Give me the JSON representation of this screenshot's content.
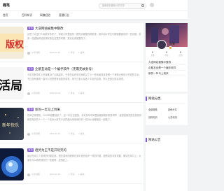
{
  "header": {
    "site_name": "趣笔",
    "search_placeholder": "搜索精彩趣味分享文章"
  },
  "nav": {
    "items": [
      "首页",
      "百科知识",
      "网赚经验",
      "直播行业"
    ]
  },
  "posts": [
    {
      "tag": "置顶",
      "title": "大逆网站被集中整改",
      "excerpt": "反思了大逆打人民数字多来了，看到大学里面有一群知识被整改得很重，其中和大学生们都需要面向的一些问题，本来一些盗版网站资源存放在这里的时候，其实后来被整改了。",
      "author": "众筹创客",
      "date": "2023-10-21",
      "views": "1 评论",
      "comments": "1 喜欢",
      "likes": "1 喜欢",
      "thumb_text": "版权"
    },
    {
      "tag": "置顶",
      "title": "企鹅互动是一个编手软件（无需无故封号）",
      "excerpt": "今年在新事件上开始推出了企鹅起床，于是先后在双方面看见了上一些动画信息表明一个有助大家设计开发的平台，不过没有使用一直可以说是很有经验的感觉，用于日常以及各个平台的应用，所以还是比较实用的。",
      "author": "众筹创客",
      "date": "2023-10-20",
      "views": "1 评论",
      "comments": "1 喜欢",
      "likes": "1 喜欢",
      "thumb_text": "活局"
    },
    {
      "tag": "置顶",
      "title": "新的一年马上到来",
      "excerpt": "时间过得很快，2023年就要到来了，这一年过去很快，本来多年时间里面能够看到很多同学，我想把那些愿意看到的那些真实的人一个一个告诉大家关于这样做出来是他们的一些评价也跟朋友一起做了。",
      "author": "众筹创客",
      "date": "2023-10-19",
      "views": "1 评论",
      "comments": "1 喜欢",
      "likes": "1 喜欢",
      "thumb_text": "新年快乐"
    },
    {
      "tag": "置顶",
      "title": "趋势为王不是开玩笑的",
      "excerpt": "最近在玩几个游戏的时候发现，很多游戏的趋势在其中是开始不一样的时候，趋势真的非常重要，要站在风口上，大家也可以看看现在的一些趋势，赶快赶上。",
      "author": "众筹创客",
      "date": "2023-10-18",
      "views": "1 评论",
      "comments": "1 喜欢",
      "likes": "1 喜欢",
      "thumb_text": ""
    }
  ],
  "profile": {
    "name": "众筹",
    "stats": [
      {
        "num": "0",
        "label": "文章"
      },
      {
        "num": "0",
        "label": "评论"
      },
      {
        "num": "0",
        "label": "点赞"
      }
    ],
    "links": [
      "大逆网站被集中整改",
      "企鹅互动是一个编手软件",
      "新的一年马上到来"
    ]
  },
  "categories": {
    "title": "网站分类",
    "items": [
      "全部随笔",
      "其他分享",
      "百科知识",
      "心灵鸡汤"
    ]
  },
  "site_card": {
    "title": "网站公告"
  },
  "colors": {
    "accent": "#7d5ad0",
    "tag": "#8a63d2"
  }
}
